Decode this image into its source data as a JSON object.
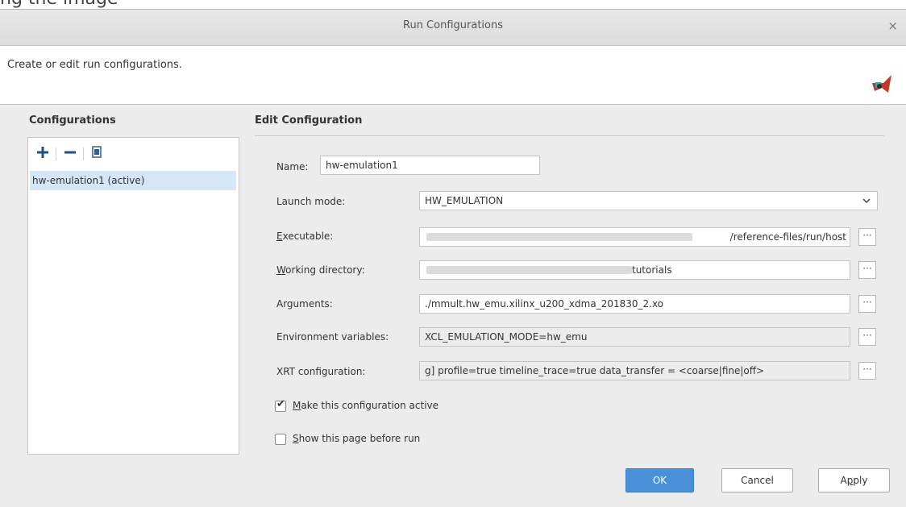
{
  "above_text": "ng the image",
  "dialog": {
    "title": "Run Configurations",
    "close_icon": "×",
    "header_text": "Create or edit run configurations."
  },
  "configurations": {
    "title": "Configurations",
    "toolbar": {
      "add_icon": "plus-icon",
      "remove_icon": "minus-icon",
      "duplicate_icon": "duplicate-icon"
    },
    "items": [
      "hw-emulation1 (active)"
    ]
  },
  "edit": {
    "title": "Edit Configuration",
    "name_label": "Name:",
    "name_value": "hw-emulation1",
    "launch_mode_label": "Launch mode:",
    "launch_mode_value": "HW_EMULATION",
    "executable_label_first": "E",
    "executable_label_rest": "xecutable:",
    "executable_value": "/reference-files/run/host",
    "working_dir_label_first": "W",
    "working_dir_label_rest": "orking directory:",
    "working_dir_value": "tutorials",
    "arguments_label": "Arguments:",
    "arguments_value": "./mmult.hw_emu.xilinx_u200_xdma_201830_2.xo",
    "env_label": "Environment variables:",
    "env_value": "XCL_EMULATION_MODE=hw_emu",
    "xrt_label": "XRT configuration:",
    "xrt_value": "g] profile=true timeline_trace=true data_transfer = <coarse|fine|off>",
    "browse_label": "···",
    "make_active_first": "M",
    "make_active_rest": "ake this configuration active",
    "make_active_checked": true,
    "show_page_first": "S",
    "show_page_rest": "how this page before run",
    "show_page_checked": false
  },
  "buttons": {
    "ok": "OK",
    "cancel": "Cancel",
    "apply_first": "A",
    "apply_underlined": "p",
    "apply_rest": "ply"
  }
}
